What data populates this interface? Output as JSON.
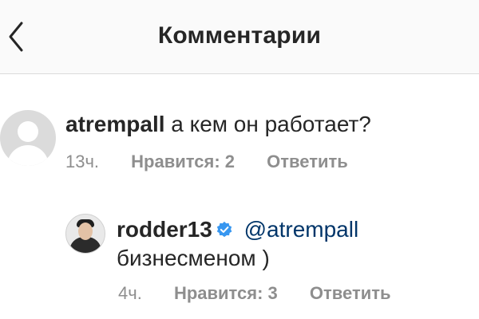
{
  "header": {
    "title": "Комментарии",
    "back_icon": "chevron-left-icon"
  },
  "comments": [
    {
      "username": "atrempall",
      "text": "а кем он работает?",
      "time": "13ч.",
      "likes": "Нравится: 2",
      "reply": "Ответить",
      "avatar": "default-avatar-icon"
    },
    {
      "username": "rodder13",
      "verified": true,
      "mention": "@atrempall",
      "text": "бизнесменом )",
      "time": "4ч.",
      "likes": "Нравится: 3",
      "reply": "Ответить",
      "avatar": "user-avatar"
    }
  ],
  "colors": {
    "text": "#262626",
    "muted": "#8e8e8e",
    "mention": "#003569",
    "verified": "#3897f0",
    "divider": "#dbdbdb"
  }
}
